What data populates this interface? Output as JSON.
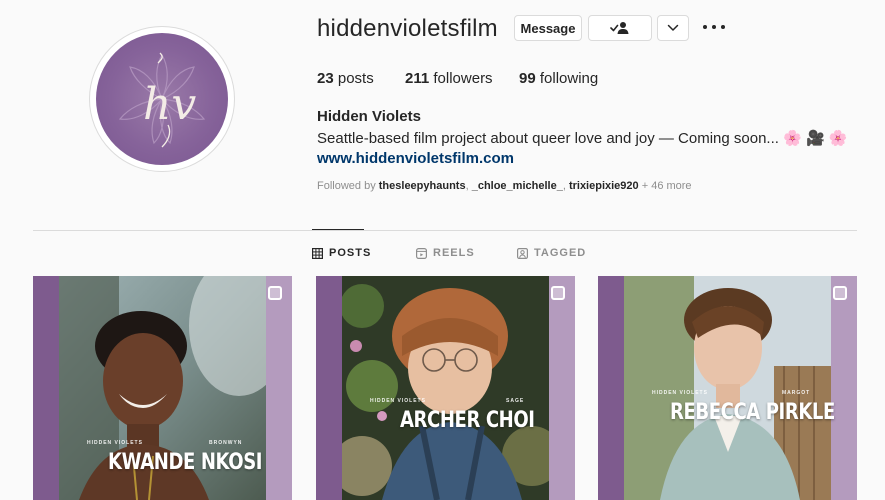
{
  "profile": {
    "username": "hiddenvioletsfilm",
    "full_name": "Hidden Violets",
    "bio_text": "Seattle-based film project about queer love and joy — Coming soon...",
    "bio_emoji": "🌸 🎥 🌸",
    "website": "www.hiddenvioletsfilm.com",
    "avatar_monogram": "hv"
  },
  "actions": {
    "message_label": "Message",
    "follow_icon": "person-check-icon",
    "more_icon": "chevron-down-icon",
    "options_icon": "three-dots-icon"
  },
  "stats": {
    "posts_count": "23",
    "posts_label": "posts",
    "followers_count": "211",
    "followers_label": "followers",
    "following_count": "99",
    "following_label": "following"
  },
  "followed_by": {
    "prefix": "Followed by",
    "users": [
      "thesleepyhaunts",
      "_chloe_michelle_",
      "trixiepixie920"
    ],
    "more": "+ 46 more"
  },
  "tabs": [
    {
      "label": "POSTS",
      "icon": "grid-icon",
      "active": true
    },
    {
      "label": "REELS",
      "icon": "reels-icon",
      "active": false
    },
    {
      "label": "TAGGED",
      "icon": "tagged-icon",
      "active": false
    }
  ],
  "posts": [
    {
      "brand": "HIDDEN VIOLETS",
      "role": "BRONWYN",
      "name": "KWANDE NKOSI"
    },
    {
      "brand": "HIDDEN VIOLETS",
      "role": "SAGE",
      "name": "ARCHER CHOI"
    },
    {
      "brand": "HIDDEN VIOLETS",
      "role": "MARGOT",
      "name": "REBECCA PIRKLE"
    }
  ],
  "colors": {
    "accent_purple": "#7e5b8e",
    "link_blue": "#00376b",
    "text": "#262626",
    "muted": "#8e8e8e",
    "border": "#dbdbdb"
  }
}
